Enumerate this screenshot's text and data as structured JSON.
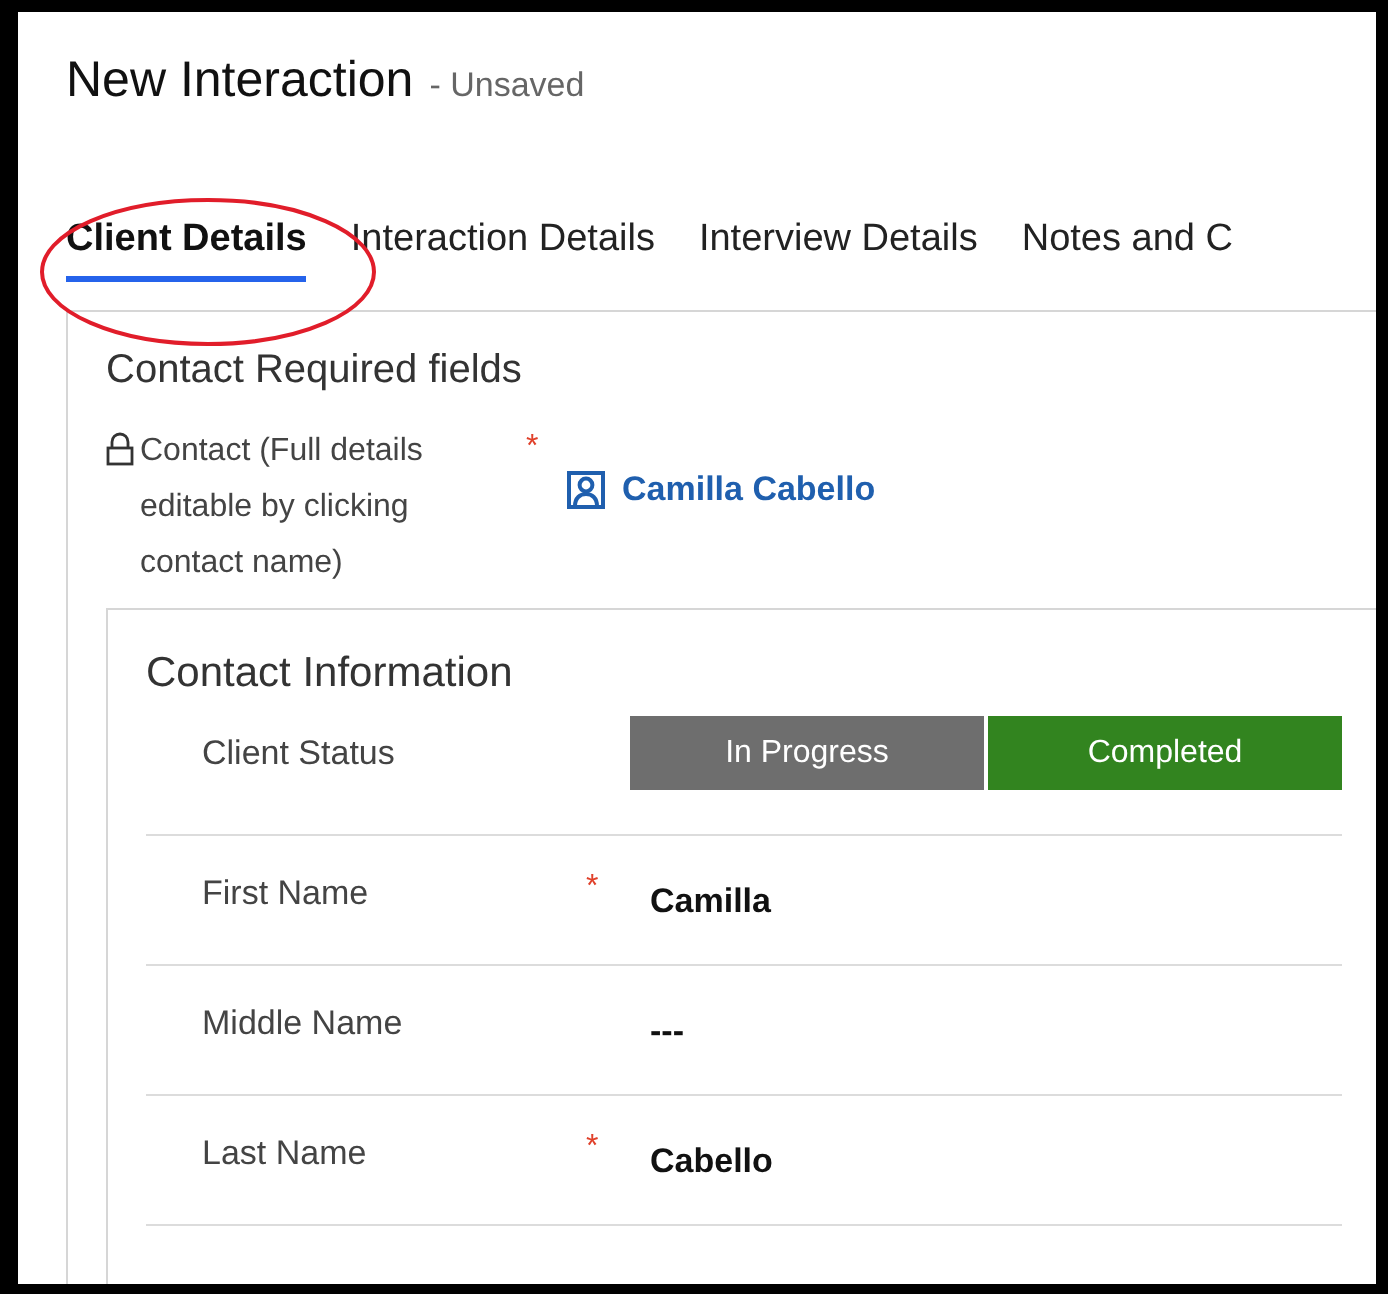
{
  "title": "New Interaction",
  "subtitle": "- Unsaved",
  "tabs": [
    {
      "label": "Client Details",
      "selected": true
    },
    {
      "label": "Interaction Details",
      "selected": false
    },
    {
      "label": "Interview Details",
      "selected": false
    },
    {
      "label": "Notes and C",
      "selected": false
    }
  ],
  "section": {
    "title": "Contact Required fields",
    "contact": {
      "label": "Contact (Full details editable by clicking contact name)",
      "locked": true,
      "required_mark": "*",
      "value": "Camilla Cabello"
    }
  },
  "card": {
    "title": "Contact Information",
    "status": {
      "label": "Client Status",
      "options": [
        {
          "label": "In Progress",
          "selected": false
        },
        {
          "label": "Completed",
          "selected": true
        }
      ]
    },
    "fields": [
      {
        "label": "First Name",
        "required_mark": "*",
        "value": "Camilla"
      },
      {
        "label": "Middle Name",
        "value": "---"
      },
      {
        "label": "Last Name",
        "required_mark": "*",
        "value": "Cabello"
      }
    ]
  }
}
